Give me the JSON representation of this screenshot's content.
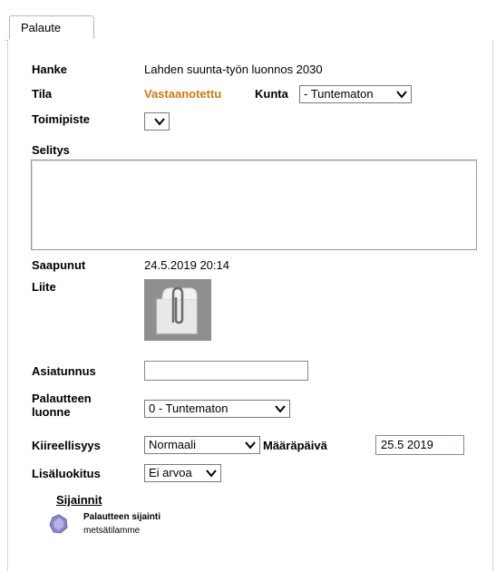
{
  "tab": {
    "label": "Palaute"
  },
  "fields": {
    "hanke": {
      "label": "Hanke",
      "value": "Lahden suunta-työn luonnos 2030"
    },
    "tila": {
      "label": "Tila",
      "value": "Vastaanotettu"
    },
    "kunta": {
      "label": "Kunta",
      "value": "- Tuntematon"
    },
    "toimipiste": {
      "label": "Toimipiste",
      "value": ""
    },
    "selitys": {
      "label": "Selitys",
      "value": ""
    },
    "saapunut": {
      "label": "Saapunut",
      "value": "24.5.2019 20:14"
    },
    "liite": {
      "label": "Liite"
    },
    "asiatunnus": {
      "label": "Asiatunnus",
      "value": ""
    },
    "palautteen_luonne": {
      "label_line1": "Palautteen",
      "label_line2": "luonne",
      "value": "0 - Tuntematon"
    },
    "kiireellisyys": {
      "label": "Kiireellisyys",
      "value": "Normaali"
    },
    "maarapaiva": {
      "label": "Määräpäivä",
      "value": "25.5 2019"
    },
    "lisaluokitus": {
      "label": "Lisäluokitus",
      "value": "Ei arvoa"
    }
  },
  "sijainnit": {
    "title": "Sijainnit",
    "item_title": "Palautteen sijainti",
    "item_subtitle": "metsätilamme"
  },
  "colors": {
    "status": "#d17a12"
  },
  "icons": {
    "dropdown": "chevron-down-icon",
    "attachment": "paperclip-icon",
    "location": "map-marker-icon"
  }
}
